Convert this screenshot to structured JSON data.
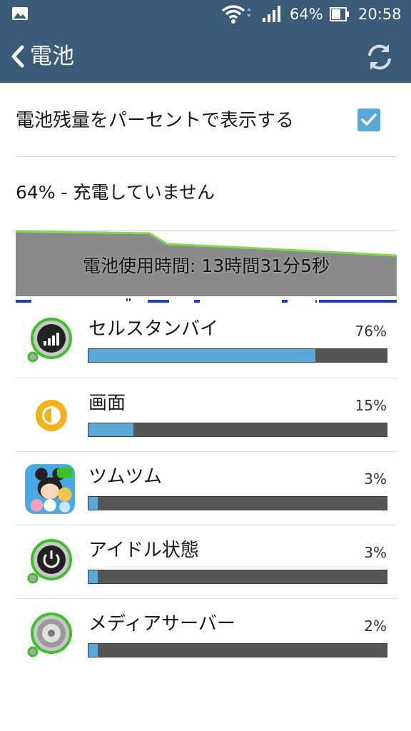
{
  "status_bar": {
    "battery_percent": "64%",
    "time": "20:58",
    "icons": [
      "gallery-icon",
      "wifi-icon",
      "signal-icon",
      "battery-icon"
    ]
  },
  "app_bar": {
    "title": "電池",
    "icons": [
      "back-icon",
      "refresh-icon"
    ]
  },
  "settings": {
    "show_percent_label": "電池残量をパーセントで表示する",
    "show_percent_checked": true
  },
  "status": {
    "text": "64% - 充電していません"
  },
  "graph": {
    "label": "電池使用時間: 13時間31分5秒",
    "fill_color": "#8a8a8a",
    "line_color": "#7ddb4a",
    "charge_line_color": "#2040c0"
  },
  "usage": [
    {
      "name": "セルスタンバイ",
      "percent_label": "76%",
      "fraction": 0.76,
      "icon": "cell-standby-icon"
    },
    {
      "name": "画面",
      "percent_label": "15%",
      "fraction": 0.15,
      "icon": "screen-brightness-icon"
    },
    {
      "name": "ツムツム",
      "percent_label": "3%",
      "fraction": 0.03,
      "icon": "tsumtsum-app-icon"
    },
    {
      "name": "アイドル状態",
      "percent_label": "3%",
      "fraction": 0.03,
      "icon": "idle-power-icon"
    },
    {
      "name": "メディアサーバー",
      "percent_label": "2%",
      "fraction": 0.02,
      "icon": "media-server-icon"
    }
  ],
  "colors": {
    "app_bar": "#3a5a78",
    "accent": "#5aa8d8",
    "bar_track": "#555555"
  }
}
